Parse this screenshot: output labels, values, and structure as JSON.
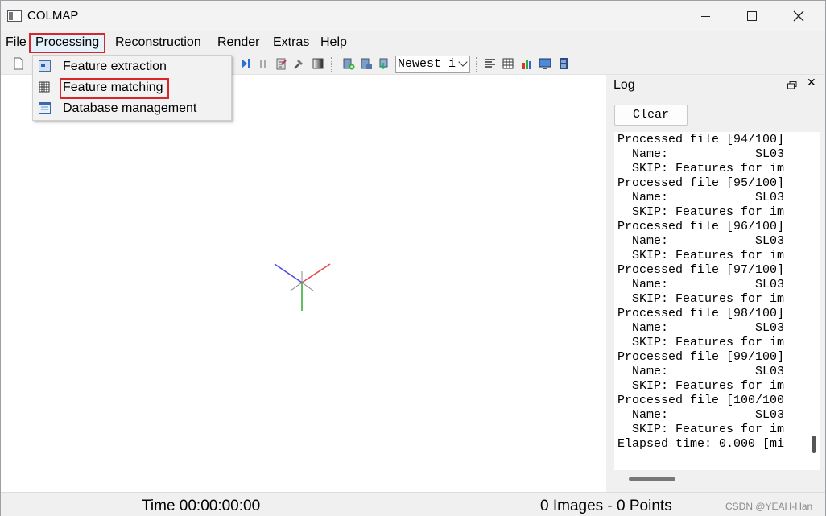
{
  "window": {
    "title": "COLMAP"
  },
  "menubar": {
    "items": [
      {
        "label": "File"
      },
      {
        "label": "Processing"
      },
      {
        "label": "Reconstruction"
      },
      {
        "label": "Render"
      },
      {
        "label": "Extras"
      },
      {
        "label": "Help"
      }
    ]
  },
  "toolbar": {
    "combo_value": "Newest i"
  },
  "processing_menu": {
    "items": [
      {
        "label": "Feature extraction"
      },
      {
        "label": "Feature matching"
      },
      {
        "label": "Database management"
      }
    ]
  },
  "log": {
    "title": "Log",
    "clear_label": "Clear",
    "lines": "Processed file [94/100]\n  Name:            SL03\n  SKIP: Features for im\nProcessed file [95/100]\n  Name:            SL03\n  SKIP: Features for im\nProcessed file [96/100]\n  Name:            SL03\n  SKIP: Features for im\nProcessed file [97/100]\n  Name:            SL03\n  SKIP: Features for im\nProcessed file [98/100]\n  Name:            SL03\n  SKIP: Features for im\nProcessed file [99/100]\n  Name:            SL03\n  SKIP: Features for im\nProcessed file [100/100\n  Name:            SL03\n  SKIP: Features for im\nElapsed time: 0.000 [mi"
  },
  "statusbar": {
    "time": "Time 00:00:00:00",
    "counts": "0 Images - 0 Points",
    "watermark": "CSDN @YEAH-Han"
  },
  "colors": {
    "highlight_box": "#d9262d",
    "axis_x": "#e04848",
    "axis_y": "#2ea82e",
    "axis_z": "#4a4ae0"
  }
}
